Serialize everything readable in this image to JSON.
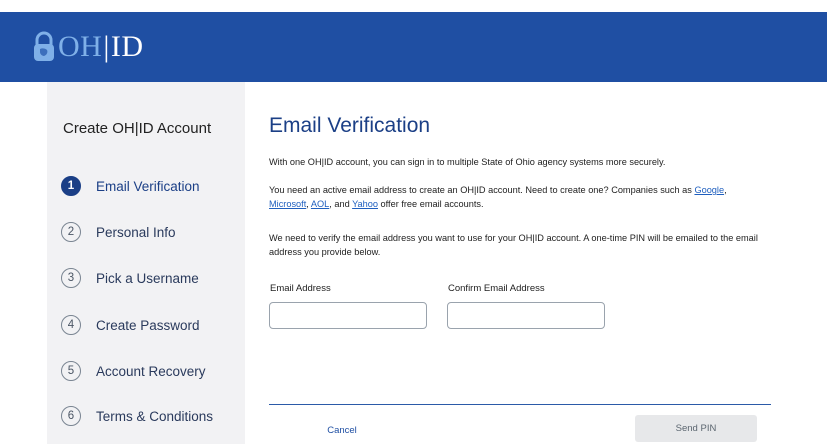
{
  "header": {
    "logo_oh": "OH",
    "logo_sep": "|",
    "logo_id": "ID",
    "bg_color": "#1f4fa3"
  },
  "sidebar": {
    "title": "Create OH|ID Account",
    "steps": [
      {
        "num": "1",
        "label": "Email Verification",
        "active": true
      },
      {
        "num": "2",
        "label": "Personal Info",
        "active": false
      },
      {
        "num": "3",
        "label": "Pick a Username",
        "active": false
      },
      {
        "num": "4",
        "label": "Create Password",
        "active": false
      },
      {
        "num": "5",
        "label": "Account Recovery",
        "active": false
      },
      {
        "num": "6",
        "label": "Terms & Conditions",
        "active": false
      }
    ]
  },
  "main": {
    "title": "Email Verification",
    "intro": "With one OH|ID account, you can sign in to multiple State of Ohio agency systems more securely.",
    "need_prefix": "You need an active email address to create an OH|ID account. Need to create one? Companies such as ",
    "link_google": "Google",
    "comma1": ",",
    "link_microsoft": "Microsoft",
    "comma2": ", ",
    "link_aol": "AOL",
    "and_text": ", and ",
    "link_yahoo": "Yahoo",
    "need_suffix": " offer free email accounts.",
    "verify_text": "We need to verify the email address you want to use for your OH|ID account. A one-time PIN will be emailed to the email address you provide below.",
    "email_label": "Email Address",
    "confirm_label": "Confirm Email Address",
    "email_value": "",
    "confirm_value": ""
  },
  "footer": {
    "cancel_label": "Cancel",
    "send_pin_label": "Send PIN"
  }
}
